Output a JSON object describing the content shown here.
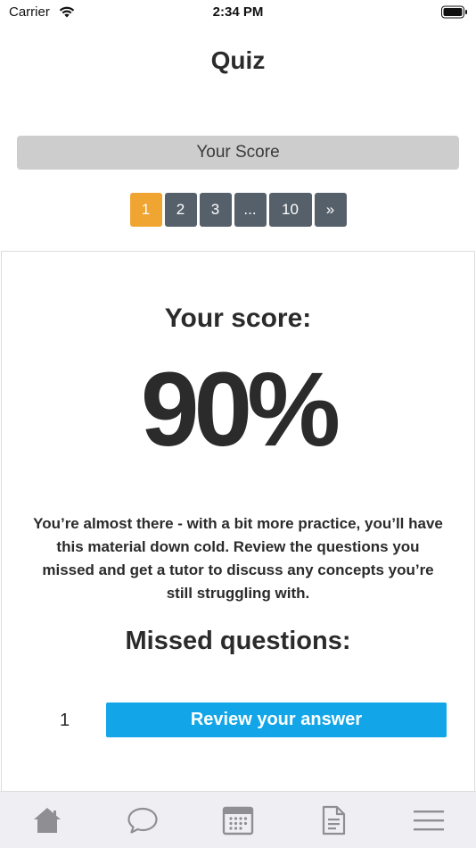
{
  "status_bar": {
    "carrier": "Carrier",
    "time": "2:34 PM"
  },
  "nav": {
    "title": "Quiz"
  },
  "score_bar": {
    "label": "Your Score"
  },
  "pagination": {
    "pages": [
      "1",
      "2",
      "3",
      "...",
      "10",
      "»"
    ],
    "active_index": 0
  },
  "result": {
    "score_label": "Your score:",
    "score_value": "90%",
    "feedback": "You’re almost there - with a bit more practice, you’ll have this material down cold. Review the questions you missed and get a tutor to discuss any concepts you’re still struggling with.",
    "missed_title": "Missed questions:",
    "missed": [
      {
        "number": "1",
        "action_label": "Review your answer"
      }
    ]
  },
  "tab_bar": {
    "tabs": [
      "home-icon",
      "chat-icon",
      "calendar-icon",
      "document-icon",
      "menu-icon"
    ]
  },
  "colors": {
    "accent_active_page": "#f0a432",
    "page_button": "#56606b",
    "review_button": "#12a6e8",
    "score_bar": "#cdcdcd",
    "tab_bar": "#efeff3"
  }
}
